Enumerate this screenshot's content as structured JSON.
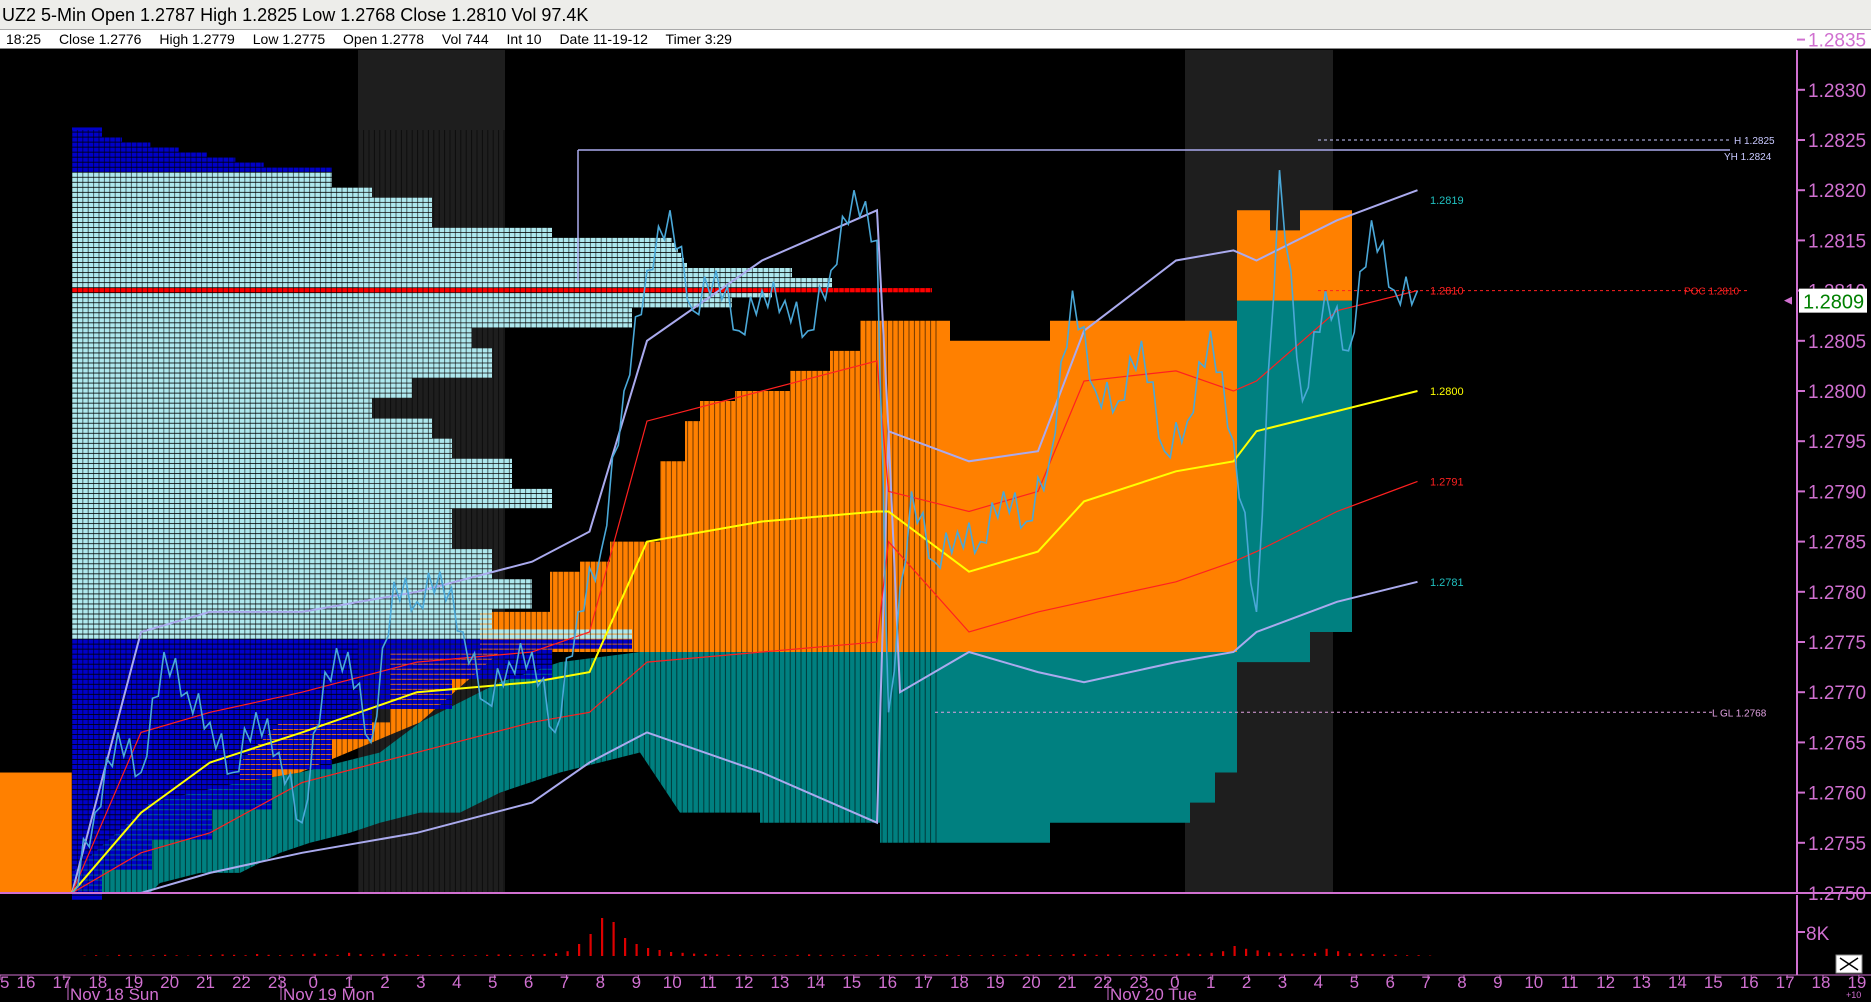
{
  "header": {
    "title": "UZ2 5-Min Open 1.2787 High 1.2825 Low 1.2768 Close 1.2810 Vol 97.4K"
  },
  "info_bar": {
    "time": "18:25",
    "close": "Close 1.2776",
    "high": "High 1.2779",
    "low": "Low 1.2775",
    "open": "Open 1.2778",
    "vol": "Vol 744",
    "int": "Int 10",
    "date": "Date 11-19-12",
    "timer": "Timer 3:29"
  },
  "colors": {
    "background": "#000000",
    "axis": "#d070d0",
    "session_shade": "#1e1e1e",
    "value_area_orange": "#ff8000",
    "value_area_teal": "#008080",
    "profile_light": "#aee8ee",
    "profile_blue": "#0000c8",
    "poc_red": "#ff0000",
    "price_line": "#4aa8d8",
    "band_lavender": "#aaaaee",
    "band_red": "#ff2020",
    "vwap_yellow": "#ffff00",
    "volume_red": "#dd0000",
    "current_price_bg": "#ffffff",
    "current_price_text": "#008000"
  },
  "chart_data": {
    "type": "line",
    "title": "UZ2 5-Min",
    "price_axis": {
      "ylim": [
        1.2748,
        1.2838
      ],
      "ticks": [
        "1.2835",
        "1.2830",
        "1.2825",
        "1.2820",
        "1.2815",
        "1.2810",
        "1.2805",
        "1.2800",
        "1.2795",
        "1.2790",
        "1.2785",
        "1.2780",
        "1.2775",
        "1.2770",
        "1.2765",
        "1.2760",
        "1.2755",
        "1.2750"
      ],
      "current_price": "1.2809"
    },
    "volume_axis": {
      "ticks": [
        "8K"
      ]
    },
    "time_axis": {
      "hour_ticks": [
        "5",
        "16",
        "17",
        "18",
        "19",
        "20",
        "21",
        "22",
        "23",
        "0",
        "1",
        "2",
        "3",
        "4",
        "5",
        "6",
        "7",
        "8",
        "9",
        "10",
        "11",
        "12",
        "13",
        "14",
        "15",
        "16",
        "17",
        "18",
        "19",
        "20",
        "21",
        "22",
        "23",
        "0",
        "1",
        "2",
        "3",
        "4",
        "5",
        "6",
        "7",
        "8",
        "9",
        "10",
        "11",
        "12",
        "13",
        "14",
        "15",
        "16",
        "17",
        "18",
        "19"
      ],
      "day_labels": [
        "Nov 18 Sun",
        "Nov 19 Mon",
        "Nov 20 Tue"
      ],
      "corner_label": "+10"
    },
    "levels": [
      {
        "label": "1.2819",
        "price": 1.2819,
        "color": "#20c0c0"
      },
      {
        "label": "1.2810",
        "price": 1.281,
        "color": "#ff2020"
      },
      {
        "label": "1.2800",
        "price": 1.28,
        "color": "#ffff00"
      },
      {
        "label": "1.2791",
        "price": 1.2791,
        "color": "#ff2020"
      },
      {
        "label": "1.2781",
        "price": 1.2781,
        "color": "#20c0c0"
      }
    ],
    "reference_lines": [
      {
        "label": "H 1.2825",
        "price": 1.2825
      },
      {
        "label": "YH 1.2824",
        "price": 1.2824
      },
      {
        "label": "POC 1.2810",
        "price": 1.281
      },
      {
        "label": "L GL 1.2768",
        "price": 1.2768
      }
    ],
    "price_series": [
      [
        0,
        1.275
      ],
      [
        2,
        1.2758
      ],
      [
        4,
        1.2766
      ],
      [
        6,
        1.2762
      ],
      [
        8,
        1.2774
      ],
      [
        10,
        1.277
      ],
      [
        12,
        1.2767
      ],
      [
        14,
        1.2762
      ],
      [
        16,
        1.2768
      ],
      [
        18,
        1.2764
      ],
      [
        20,
        1.2757
      ],
      [
        22,
        1.2772
      ],
      [
        24,
        1.2774
      ],
      [
        26,
        1.2765
      ],
      [
        28,
        1.2781
      ],
      [
        30,
        1.2779
      ],
      [
        32,
        1.2782
      ],
      [
        34,
        1.2776
      ],
      [
        36,
        1.2769
      ],
      [
        38,
        1.2773
      ],
      [
        40,
        1.2774
      ],
      [
        42,
        1.2766
      ],
      [
        44,
        1.2778
      ],
      [
        46,
        1.2784
      ],
      [
        48,
        1.28
      ],
      [
        50,
        1.2812
      ],
      [
        52,
        1.2818
      ],
      [
        54,
        1.2808
      ],
      [
        56,
        1.2812
      ],
      [
        58,
        1.2806
      ],
      [
        60,
        1.281
      ],
      [
        62,
        1.2809
      ],
      [
        64,
        1.2806
      ],
      [
        66,
        1.2812
      ],
      [
        68,
        1.282
      ],
      [
        70,
        1.2815
      ],
      [
        71,
        1.2768
      ],
      [
        73,
        1.279
      ],
      [
        75,
        1.2783
      ],
      [
        77,
        1.2786
      ],
      [
        79,
        1.2785
      ],
      [
        81,
        1.279
      ],
      [
        83,
        1.2787
      ],
      [
        85,
        1.2793
      ],
      [
        87,
        1.281
      ],
      [
        89,
        1.28
      ],
      [
        91,
        1.2799
      ],
      [
        93,
        1.2805
      ],
      [
        95,
        1.2794
      ],
      [
        97,
        1.2797
      ],
      [
        99,
        1.2806
      ],
      [
        101,
        1.2795
      ],
      [
        103,
        1.2778
      ],
      [
        105,
        1.2822
      ],
      [
        107,
        1.2799
      ],
      [
        109,
        1.281
      ],
      [
        111,
        1.2804
      ],
      [
        113,
        1.2817
      ],
      [
        115,
        1.281
      ],
      [
        117,
        1.281
      ]
    ],
    "upper_band": [
      [
        0,
        1.275
      ],
      [
        6,
        1.2776
      ],
      [
        12,
        1.2778
      ],
      [
        20,
        1.2778
      ],
      [
        30,
        1.278
      ],
      [
        40,
        1.2783
      ],
      [
        45,
        1.2786
      ],
      [
        50,
        1.2805
      ],
      [
        60,
        1.2813
      ],
      [
        70,
        1.2818
      ],
      [
        71,
        1.2796
      ],
      [
        78,
        1.2793
      ],
      [
        84,
        1.2794
      ],
      [
        88,
        1.2806
      ],
      [
        96,
        1.2813
      ],
      [
        101,
        1.2814
      ],
      [
        103,
        1.2813
      ],
      [
        110,
        1.2817
      ],
      [
        117,
        1.282
      ]
    ],
    "upper_inner": [
      [
        0,
        1.275
      ],
      [
        6,
        1.2766
      ],
      [
        12,
        1.2768
      ],
      [
        20,
        1.277
      ],
      [
        30,
        1.2773
      ],
      [
        40,
        1.2774
      ],
      [
        45,
        1.2776
      ],
      [
        50,
        1.2797
      ],
      [
        60,
        1.28
      ],
      [
        70,
        1.2803
      ],
      [
        71,
        1.279
      ],
      [
        78,
        1.2788
      ],
      [
        84,
        1.279
      ],
      [
        88,
        1.2801
      ],
      [
        96,
        1.2802
      ],
      [
        101,
        1.28
      ],
      [
        103,
        1.2801
      ],
      [
        110,
        1.2808
      ],
      [
        117,
        1.281
      ]
    ],
    "vwap": [
      [
        0,
        1.275
      ],
      [
        6,
        1.2758
      ],
      [
        12,
        1.2763
      ],
      [
        20,
        1.2766
      ],
      [
        30,
        1.277
      ],
      [
        40,
        1.2771
      ],
      [
        45,
        1.2772
      ],
      [
        50,
        1.2785
      ],
      [
        60,
        1.2787
      ],
      [
        70,
        1.2788
      ],
      [
        71,
        1.2788
      ],
      [
        78,
        1.2782
      ],
      [
        84,
        1.2784
      ],
      [
        88,
        1.2789
      ],
      [
        96,
        1.2792
      ],
      [
        101,
        1.2793
      ],
      [
        103,
        1.2796
      ],
      [
        110,
        1.2798
      ],
      [
        117,
        1.28
      ]
    ],
    "lower_inner": [
      [
        0,
        1.275
      ],
      [
        6,
        1.2754
      ],
      [
        12,
        1.2756
      ],
      [
        20,
        1.2761
      ],
      [
        30,
        1.2764
      ],
      [
        40,
        1.2767
      ],
      [
        45,
        1.2768
      ],
      [
        50,
        1.2773
      ],
      [
        60,
        1.2774
      ],
      [
        70,
        1.2775
      ],
      [
        71,
        1.2785
      ],
      [
        78,
        1.2776
      ],
      [
        84,
        1.2778
      ],
      [
        88,
        1.2779
      ],
      [
        96,
        1.2781
      ],
      [
        101,
        1.2783
      ],
      [
        103,
        1.2784
      ],
      [
        110,
        1.2788
      ],
      [
        117,
        1.2791
      ]
    ],
    "lower_band": [
      [
        0,
        1.275
      ],
      [
        6,
        1.275
      ],
      [
        12,
        1.2752
      ],
      [
        20,
        1.2754
      ],
      [
        30,
        1.2756
      ],
      [
        40,
        1.2759
      ],
      [
        45,
        1.2763
      ],
      [
        50,
        1.2766
      ],
      [
        60,
        1.2762
      ],
      [
        70,
        1.2757
      ],
      [
        71,
        1.2796
      ],
      [
        72,
        1.277
      ],
      [
        78,
        1.2774
      ],
      [
        84,
        1.2772
      ],
      [
        88,
        1.2771
      ],
      [
        96,
        1.2773
      ],
      [
        101,
        1.2774
      ],
      [
        103,
        1.2776
      ],
      [
        110,
        1.2779
      ],
      [
        117,
        1.2781
      ]
    ],
    "volume": [
      0,
      1,
      2,
      1,
      3,
      2,
      1,
      2,
      3,
      2,
      1,
      2,
      3,
      4,
      3,
      2,
      5,
      3,
      2,
      3,
      4,
      6,
      4,
      3,
      8,
      5,
      3,
      6,
      4,
      3,
      3,
      2,
      2,
      3,
      2,
      2,
      3,
      4,
      3,
      2,
      4,
      5,
      7,
      12,
      30,
      55,
      95,
      85,
      45,
      30,
      20,
      15,
      10,
      8,
      6,
      5,
      4,
      3,
      3,
      2,
      3,
      2,
      2,
      3,
      4,
      3,
      2,
      3,
      2,
      2,
      3,
      2,
      2,
      3,
      3,
      2,
      3,
      2,
      2,
      2,
      3,
      2,
      3,
      4,
      3,
      2,
      3,
      5,
      4,
      3,
      4,
      3,
      2,
      3,
      4,
      3,
      5,
      6,
      4,
      8,
      12,
      25,
      18,
      14,
      9,
      7,
      6,
      5,
      8,
      18,
      12,
      7,
      6,
      5,
      4,
      3,
      2,
      2,
      1
    ]
  }
}
